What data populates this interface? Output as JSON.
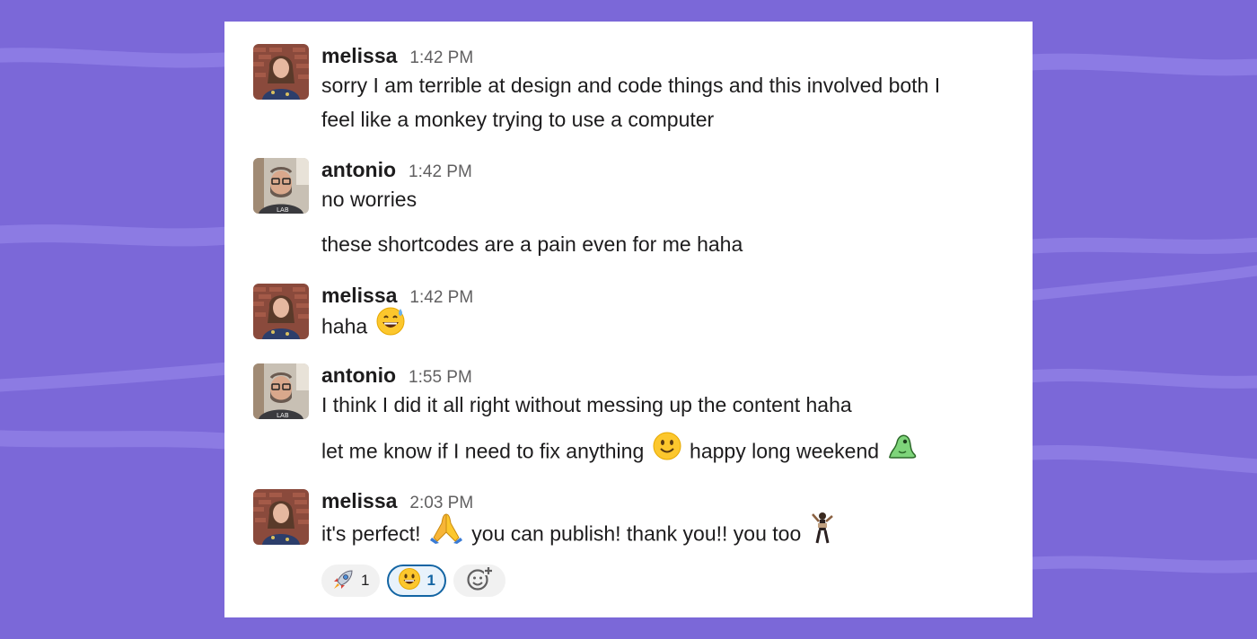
{
  "colors": {
    "background": "#7b68d8",
    "card": "#ffffff",
    "text": "#1d1c1d",
    "timestamp": "#616061",
    "reaction_active_border": "#1264a3"
  },
  "messages": [
    {
      "user": "melissa",
      "time": "1:42 PM",
      "avatar": "melissa-avatar",
      "lines": [
        "sorry I am terrible at design and code things and this involved both I",
        "feel like a monkey trying to use a computer"
      ]
    },
    {
      "user": "antonio",
      "time": "1:42 PM",
      "avatar": "antonio-avatar",
      "lines": [
        "no worries",
        "these shortcodes are a pain even for me haha"
      ]
    },
    {
      "user": "melissa",
      "time": "1:42 PM",
      "avatar": "melissa-avatar",
      "lines": [
        "haha"
      ],
      "emojis": [
        "grinning-sweat-emoji"
      ]
    },
    {
      "user": "antonio",
      "time": "1:55 PM",
      "avatar": "antonio-avatar",
      "lines": [
        "I think I did it all right without messing up the content haha",
        "let me know if I need to fix anything",
        "happy long weekend"
      ],
      "emojis": [
        "slightly-smiling-emoji",
        "green-blob-emoji"
      ]
    },
    {
      "user": "melissa",
      "time": "2:03 PM",
      "avatar": "melissa-avatar",
      "segments": [
        "it's perfect!",
        "you can publish! thank you!! you too"
      ],
      "emojis": [
        "praying-hands-emoji",
        "dancing-figure-emoji"
      ],
      "reactions": [
        {
          "icon": "rocket-emoji",
          "count": "1",
          "active": false
        },
        {
          "icon": "smiley-emoji",
          "count": "1",
          "active": true
        },
        {
          "icon": "add-reaction-icon",
          "count": null,
          "active": false
        }
      ]
    }
  ]
}
